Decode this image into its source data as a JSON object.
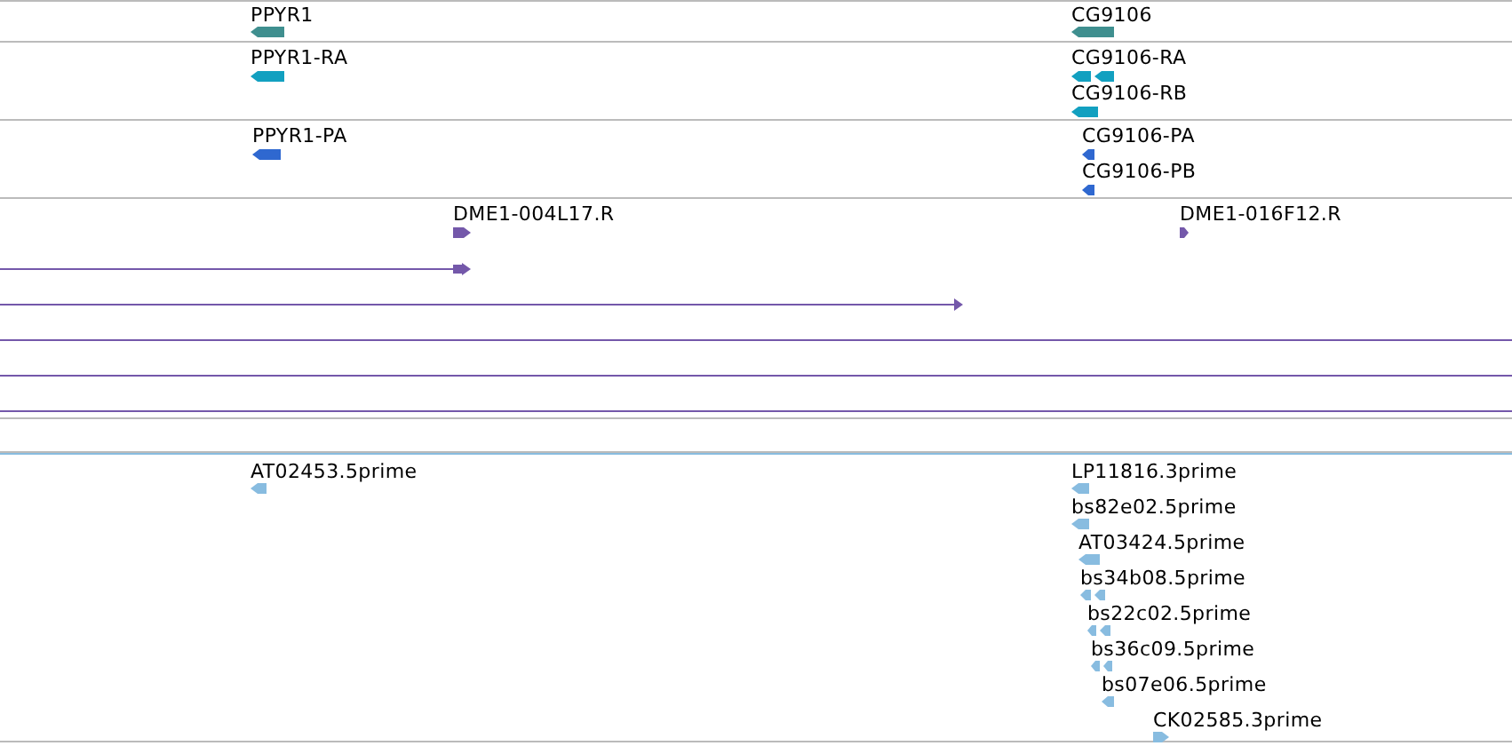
{
  "tracks": [
    {
      "color": "#3f8f8f",
      "features": [
        {
          "kind": "block",
          "label": "PPYR1",
          "reverse": true
        },
        {
          "kind": "block",
          "label": "CG9106",
          "reverse": true
        }
      ]
    },
    {
      "color": "#12a0c0",
      "features": [
        {
          "kind": "block",
          "label": "PPYR1-RA",
          "reverse": true
        },
        {
          "kind": "block",
          "label": "CG9106-RA",
          "reverse": true
        },
        {
          "kind": "block",
          "label": "CG9106-RB",
          "reverse": true
        }
      ]
    },
    {
      "color": "#2f68d0",
      "features": [
        {
          "kind": "block",
          "label": "PPYR1-PA",
          "reverse": true
        },
        {
          "kind": "block",
          "label": "CG9106-PA",
          "reverse": true
        },
        {
          "kind": "block",
          "label": "CG9106-PB",
          "reverse": true
        }
      ]
    },
    {
      "color": "#7458aa",
      "features": [
        {
          "kind": "block",
          "label": "DME1-004L17.R",
          "reverse": false
        },
        {
          "kind": "block",
          "label": "DME1-016F12.R",
          "reverse": false
        },
        {
          "kind": "line",
          "reverse": false
        },
        {
          "kind": "line",
          "reverse": false
        },
        {
          "kind": "line"
        },
        {
          "kind": "line"
        },
        {
          "kind": "line"
        }
      ]
    },
    {
      "color": "#88bce0",
      "features": [
        {
          "kind": "block",
          "label": "AT02453.5prime",
          "reverse": true
        },
        {
          "kind": "block",
          "label": "LP11816.3prime",
          "reverse": true
        },
        {
          "kind": "block",
          "label": "bs82e02.5prime",
          "reverse": true
        },
        {
          "kind": "block",
          "label": "AT03424.5prime",
          "reverse": true
        },
        {
          "kind": "block",
          "label": "bs34b08.5prime",
          "reverse": true
        },
        {
          "kind": "block",
          "label": "bs22c02.5prime",
          "reverse": true
        },
        {
          "kind": "block",
          "label": "bs36c09.5prime",
          "reverse": true
        },
        {
          "kind": "block",
          "label": "bs07e06.5prime",
          "reverse": true
        },
        {
          "kind": "block",
          "label": "CK02585.3prime",
          "reverse": false
        }
      ]
    }
  ]
}
